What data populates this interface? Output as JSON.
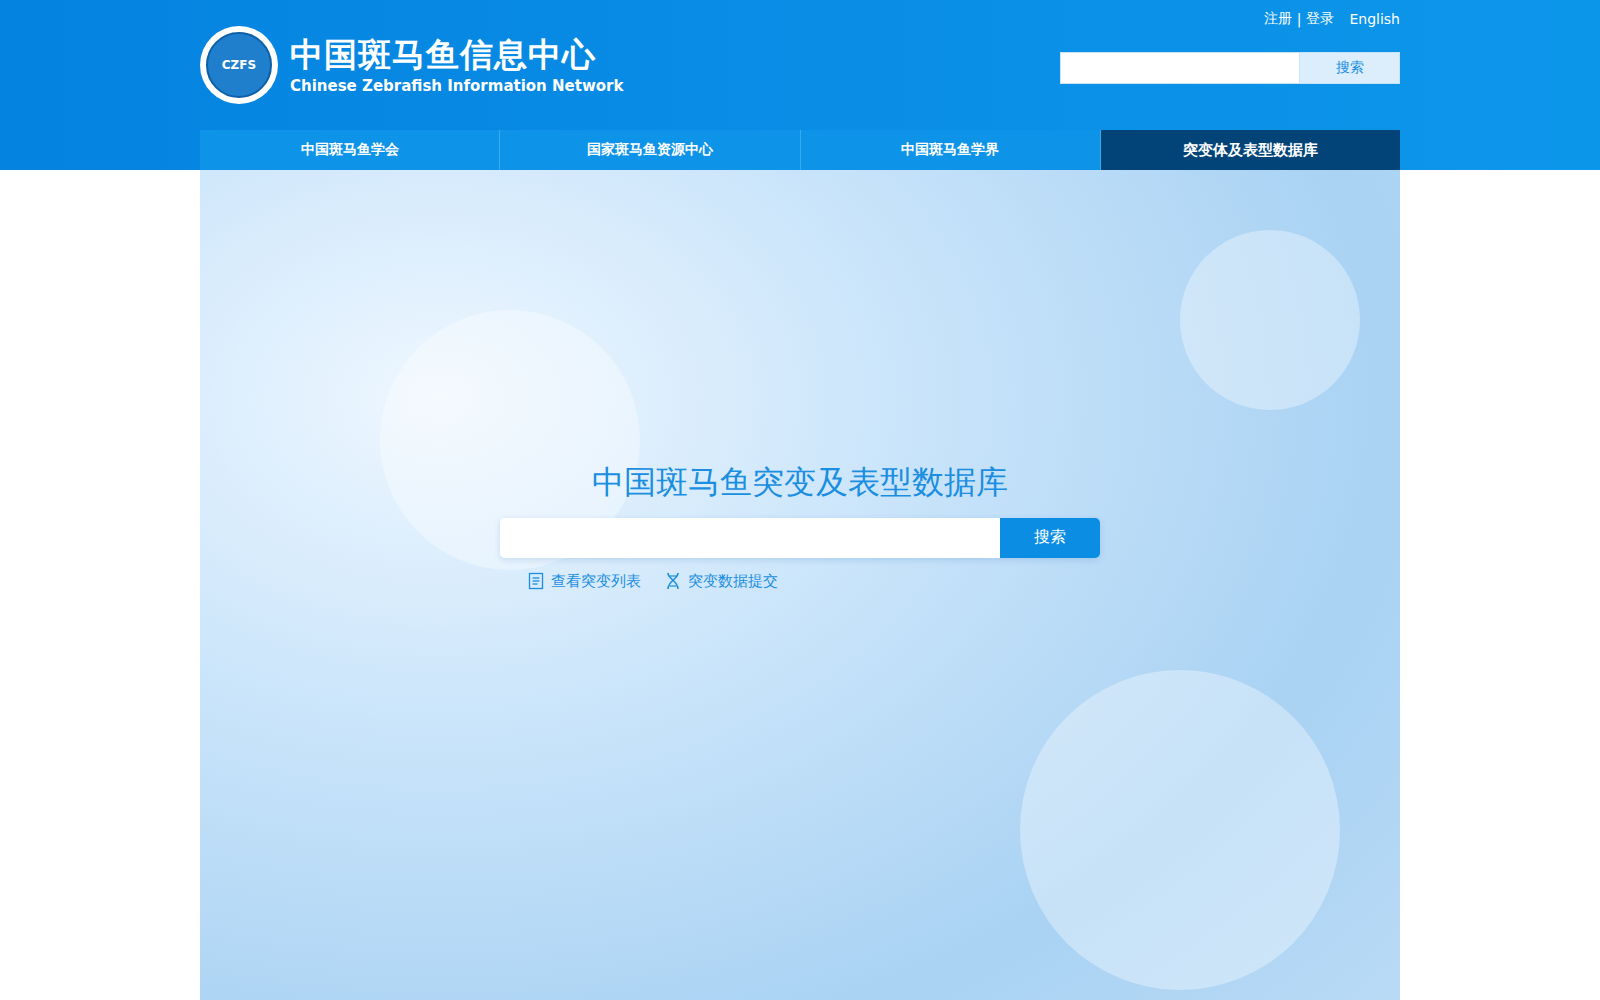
{
  "header": {
    "logo": {
      "badge": "CZFS",
      "title": "中国斑马鱼信息中心",
      "subtitle": "Chinese Zebrafish Information Network"
    },
    "links": [
      "注册",
      "登录"
    ],
    "separator": "|",
    "language": "English",
    "search": {
      "placeholder": "",
      "button": "搜索"
    }
  },
  "nav": [
    {
      "label": "中国斑马鱼学会",
      "selected": false
    },
    {
      "label": "国家斑马鱼资源中心",
      "selected": false
    },
    {
      "label": "中国斑马鱼学界",
      "selected": false
    },
    {
      "label": "突变体及表型数据库",
      "selected": true
    }
  ],
  "hero": {
    "title": "中国斑马鱼突变及表型数据库",
    "search": {
      "placeholder": "",
      "button": "搜索"
    },
    "links": [
      {
        "label": "查看突变列表",
        "kind": "list"
      },
      {
        "label": "突变数据提交",
        "kind": "dna"
      }
    ]
  }
}
